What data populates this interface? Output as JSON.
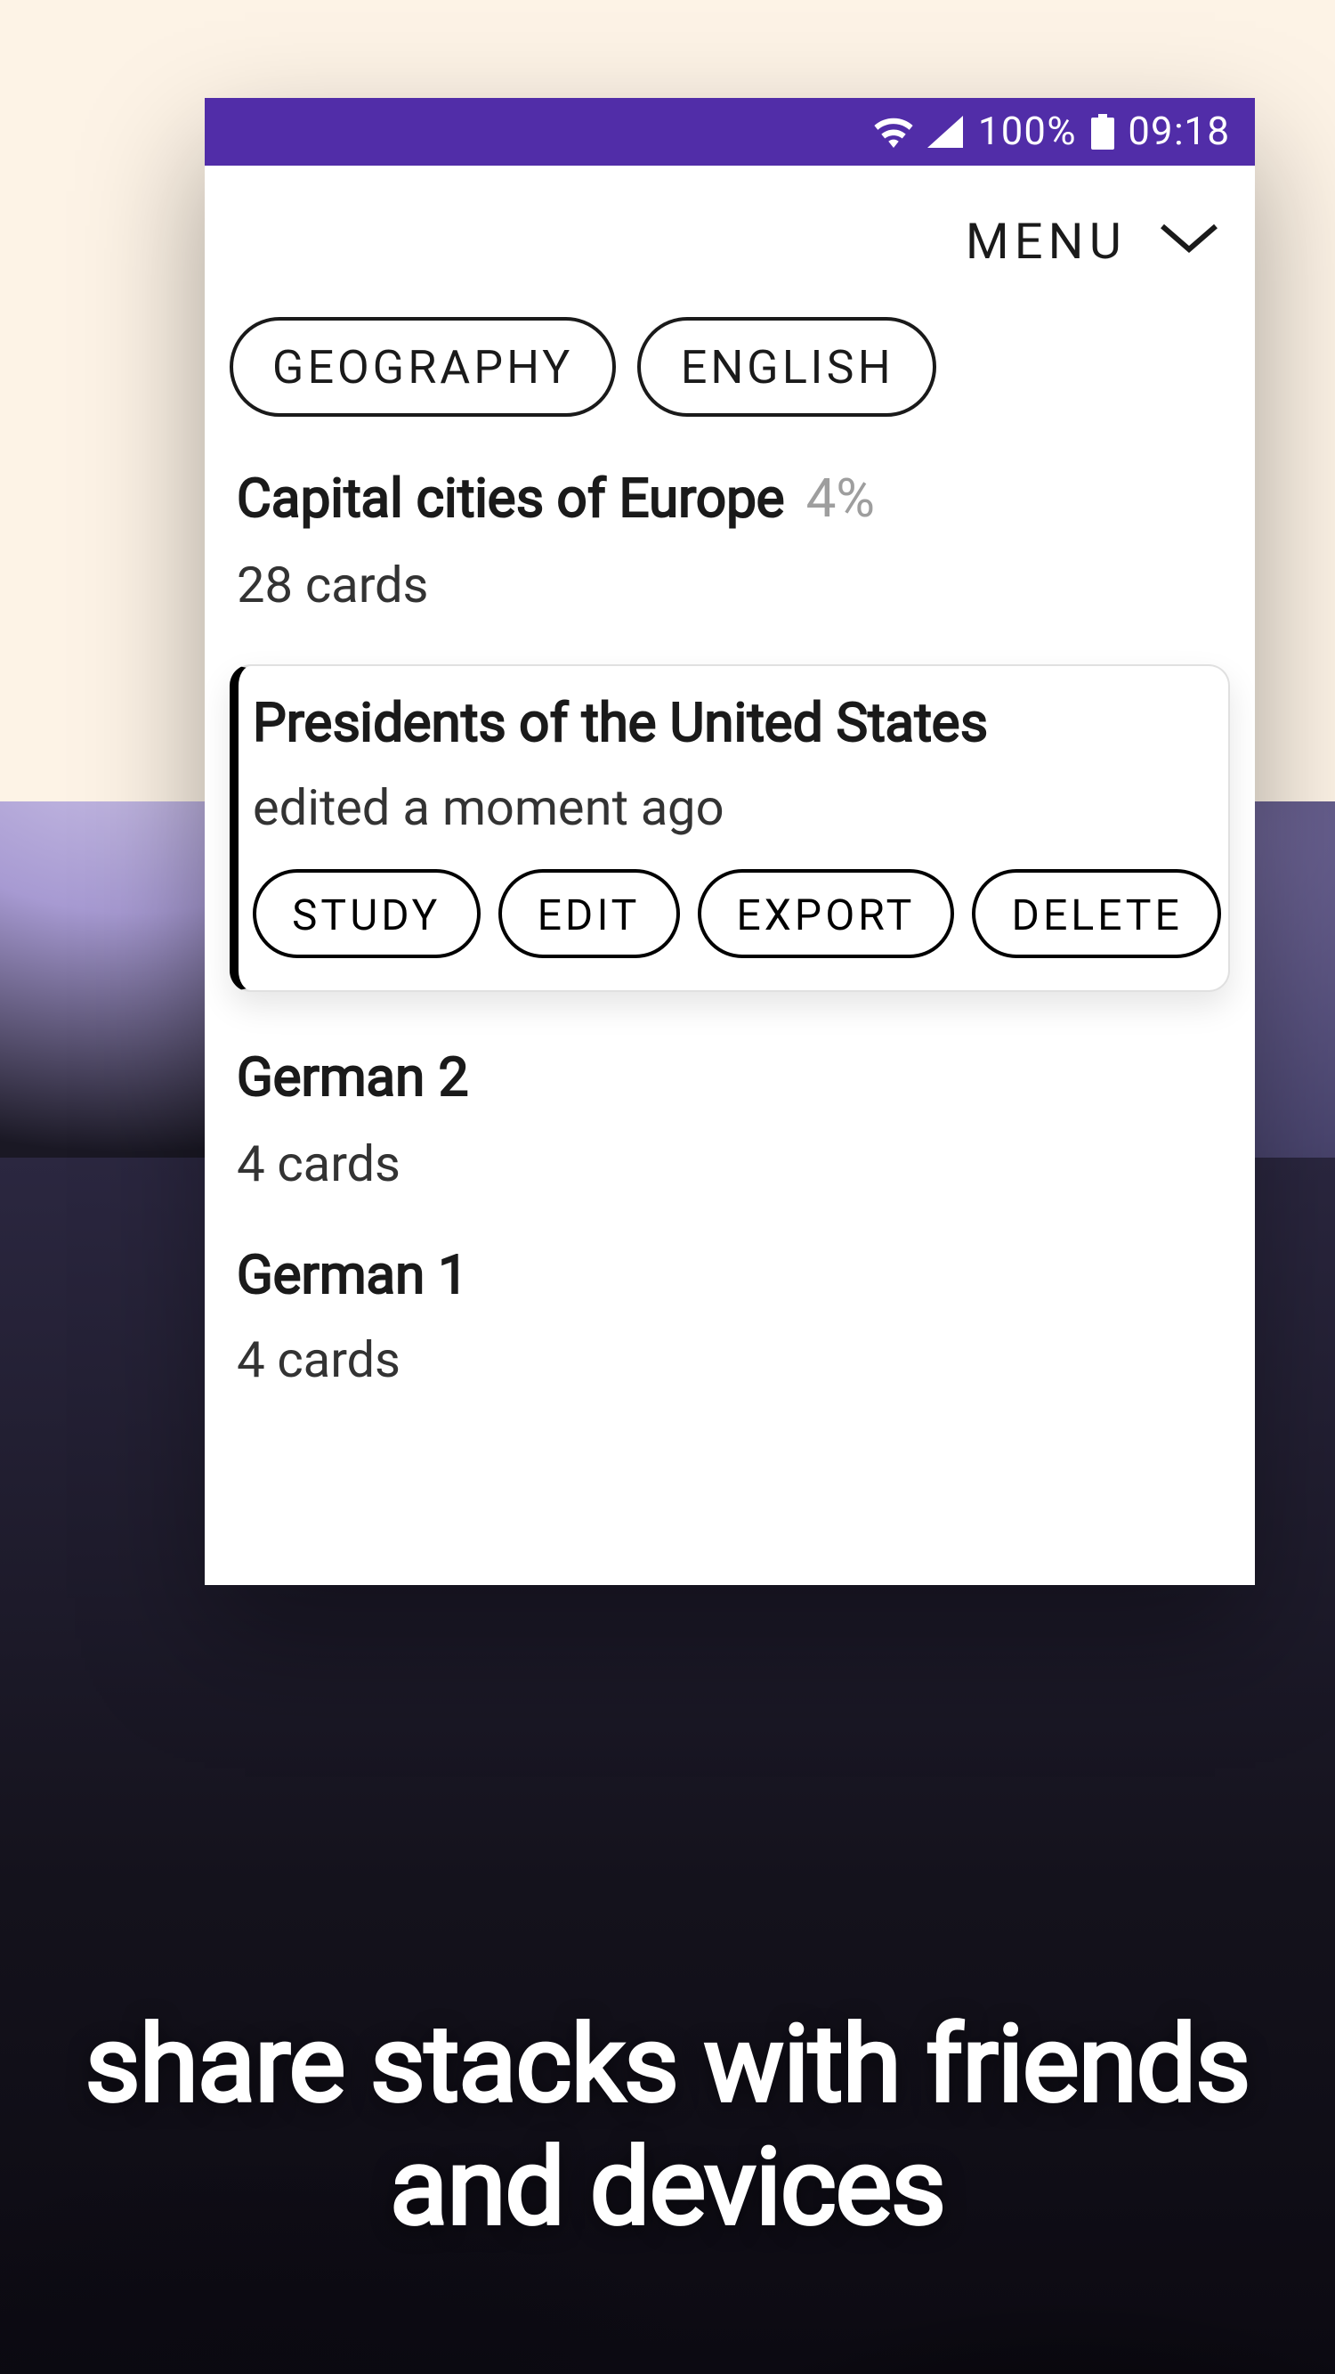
{
  "colors": {
    "statusbar_bg": "#512DA8",
    "cream": "#fdf3e6",
    "text": "#1a1a1a",
    "muted": "#9e9e9e"
  },
  "statusbar": {
    "battery_pct": "100%",
    "time": "09:18"
  },
  "appbar": {
    "menu_label": "MENU"
  },
  "chips": [
    {
      "label": "GEOGRAPHY"
    },
    {
      "label": "ENGLISH"
    }
  ],
  "stacks": [
    {
      "title": "Capital cities of Europe",
      "progress_pct": "4%",
      "subtitle": "28 cards",
      "selected": false
    },
    {
      "title": "Presidents of the United States",
      "subtitle": "edited a moment ago",
      "selected": true,
      "actions": [
        {
          "label": "STUDY"
        },
        {
          "label": "EDIT"
        },
        {
          "label": "EXPORT"
        },
        {
          "label": "DELETE"
        }
      ]
    },
    {
      "title": "German 2",
      "subtitle": "4 cards",
      "selected": false
    },
    {
      "title": "German 1",
      "subtitle": "4 cards",
      "selected": false
    }
  ],
  "tagline": "share stacks with friends and devices"
}
